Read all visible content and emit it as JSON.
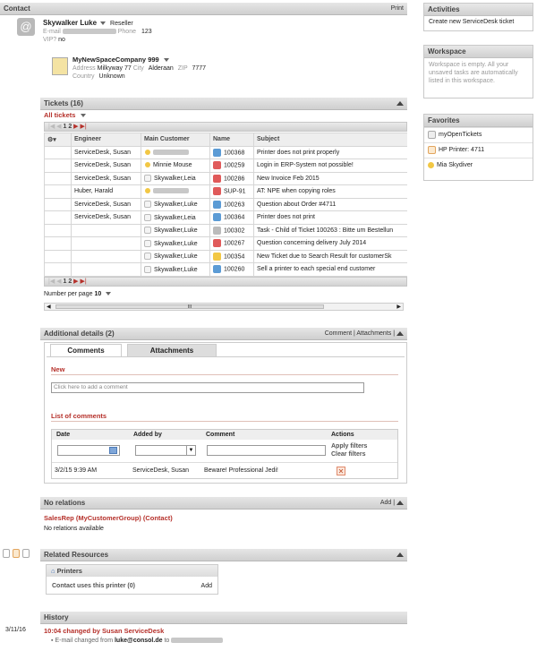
{
  "contact": {
    "header": "Contact",
    "print": "Print",
    "name": "Skywalker Luke",
    "role": "Reseller",
    "email_label": "E-mail",
    "phone_label": "Phone",
    "phone": "123",
    "vip_label": "VIP?",
    "vip": "no",
    "company": "MyNewSpaceCompany 999",
    "address_label": "Address",
    "address": "Milkyway 77",
    "city_label": "City",
    "city": "Alderaan",
    "zip_label": "ZIP",
    "zip": "7777",
    "country_label": "Country",
    "country": "Unknown"
  },
  "tickets": {
    "header": "Tickets (16)",
    "filter": "All tickets",
    "pager": "1 2",
    "columns": [
      "Engineer",
      "Main Customer",
      "Name",
      "Subject"
    ],
    "rows": [
      {
        "engineer": "ServiceDesk, Susan",
        "customer": "",
        "name": "100368",
        "subject": "Printer does not print properly",
        "icolor": "#5b9bd5"
      },
      {
        "engineer": "ServiceDesk, Susan",
        "customer": "Minnie Mouse",
        "name": "100259",
        "subject": "Login in ERP-System not possible!",
        "icolor": "#e05a5a"
      },
      {
        "engineer": "ServiceDesk, Susan",
        "customer": "Skywalker,Leia",
        "name": "100286",
        "subject": "New Invoice Feb 2015",
        "icolor": "#e05a5a"
      },
      {
        "engineer": "Huber, Harald",
        "customer": "",
        "name": "SUP-91",
        "subject": "AT: NPE when copying roles",
        "icolor": "#e05a5a"
      },
      {
        "engineer": "ServiceDesk, Susan",
        "customer": "Skywalker,Luke",
        "name": "100263",
        "subject": "Question about Order #4711",
        "icolor": "#5b9bd5"
      },
      {
        "engineer": "ServiceDesk, Susan",
        "customer": "Skywalker,Leia",
        "name": "100364",
        "subject": "Printer does not print",
        "icolor": "#5b9bd5"
      },
      {
        "engineer": "",
        "customer": "Skywalker,Luke",
        "name": "100302",
        "subject": "Task - Child of Ticket 100263 : Bitte um Bestellun",
        "icolor": "#bbbbbb"
      },
      {
        "engineer": "",
        "customer": "Skywalker,Luke",
        "name": "100267",
        "subject": "Question concerning delivery July 2014",
        "icolor": "#e05a5a"
      },
      {
        "engineer": "",
        "customer": "Skywalker,Luke",
        "name": "100354",
        "subject": "New Ticket due to Search Result for customerSk",
        "icolor": "#f2c744"
      },
      {
        "engineer": "",
        "customer": "Skywalker,Luke",
        "name": "100260",
        "subject": "Sell a printer to each special end customer",
        "icolor": "#5b9bd5"
      }
    ],
    "per_page_label": "Number per page",
    "per_page": "10",
    "scroll_mid": "III"
  },
  "details": {
    "header": "Additional details (2)",
    "comment_link": "Comment",
    "attachments_link": "Attachments",
    "tab_comments": "Comments",
    "tab_attachments": "Attachments",
    "new_label": "New",
    "placeholder": "Click here to add a comment",
    "list_label": "List of comments",
    "col_date": "Date",
    "col_added": "Added by",
    "col_comment": "Comment",
    "col_actions": "Actions",
    "apply": "Apply filters",
    "clear": "Clear filters",
    "row_date": "3/2/15 9:39 AM",
    "row_added": "ServiceDesk, Susan",
    "row_comment": "Beware! Professional Jedi!"
  },
  "relations": {
    "header": "No relations",
    "add": "Add",
    "group": "SalesRep (MyCustomerGroup) (Contact)",
    "none": "No relations available"
  },
  "resources": {
    "header": "Related Resources",
    "printers": "Printers",
    "uses": "Contact uses this printer (0)",
    "add": "Add"
  },
  "history": {
    "header": "History",
    "date": "3/11/16",
    "entry": "10:04 changed by Susan ServiceDesk",
    "detail_a": "E-mail changed from",
    "detail_b": "luke@consol.de",
    "detail_c": "to"
  },
  "sidebar": {
    "activities": "Activities",
    "create": "Create new ServiceDesk ticket",
    "workspace": "Workspace",
    "workspace_text": "Workspace is empty. All your unsaved tasks are automatically listed in this workspace.",
    "favorites": "Favorites",
    "fav1": "myOpenTickets",
    "fav2": "HP Printer: 4711",
    "fav3": "Mia Skydiver"
  }
}
